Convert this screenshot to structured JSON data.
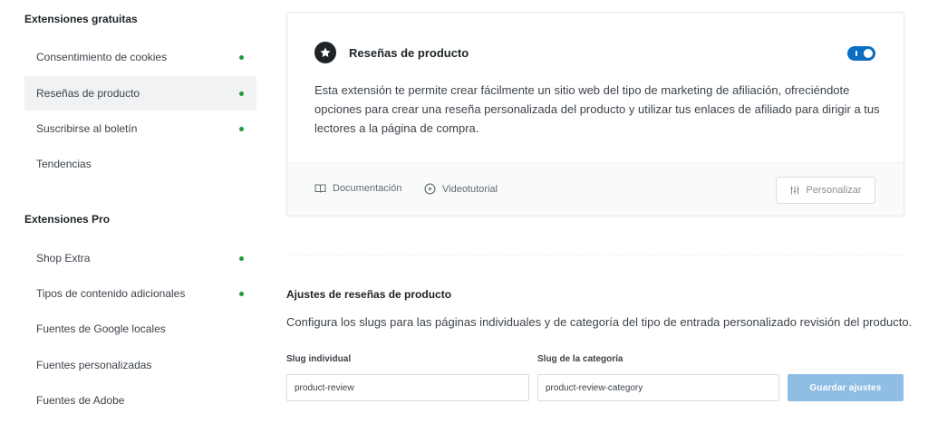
{
  "sidebar": {
    "free_title": "Extensiones gratuitas",
    "free_items": [
      {
        "label": "Consentimiento de cookies",
        "enabled": true
      },
      {
        "label": "Reseñas de producto",
        "enabled": true,
        "active": true
      },
      {
        "label": "Suscribirse al boletín",
        "enabled": true
      },
      {
        "label": "Tendencias",
        "enabled": false
      }
    ],
    "pro_title": "Extensiones Pro",
    "pro_items": [
      {
        "label": "Shop Extra",
        "enabled": true
      },
      {
        "label": "Tipos de contenido adicionales",
        "enabled": true
      },
      {
        "label": "Fuentes de Google locales",
        "enabled": false
      },
      {
        "label": "Fuentes personalizadas",
        "enabled": false
      },
      {
        "label": "Fuentes de Adobe",
        "enabled": false
      }
    ],
    "status_dot_color": "#1e9c3c"
  },
  "card": {
    "icon": "star-icon",
    "title": "Reseñas de producto",
    "toggle_on": true,
    "description": "Esta extensión te permite crear fácilmente un sitio web del tipo de marketing de afiliación, ofreciéndote opciones para crear una reseña personalizada del producto y utilizar tus enlaces de afiliado para dirigir a tus lectores a la página de compra.",
    "doc_label": "Documentación",
    "video_label": "Videotutorial",
    "personalize_label": "Personalizar",
    "accent_color": "#0c6ec2"
  },
  "settings": {
    "title": "Ajustes de reseñas de producto",
    "description": "Configura los slugs para las páginas individuales y de categoría del tipo de entrada personalizado revisión del producto.",
    "single_label": "Slug individual",
    "single_value": "product-review",
    "category_label": "Slug de la categoría",
    "category_value": "product-review-category",
    "save_label": "Guardar ajustes",
    "save_color": "#90bde4"
  }
}
